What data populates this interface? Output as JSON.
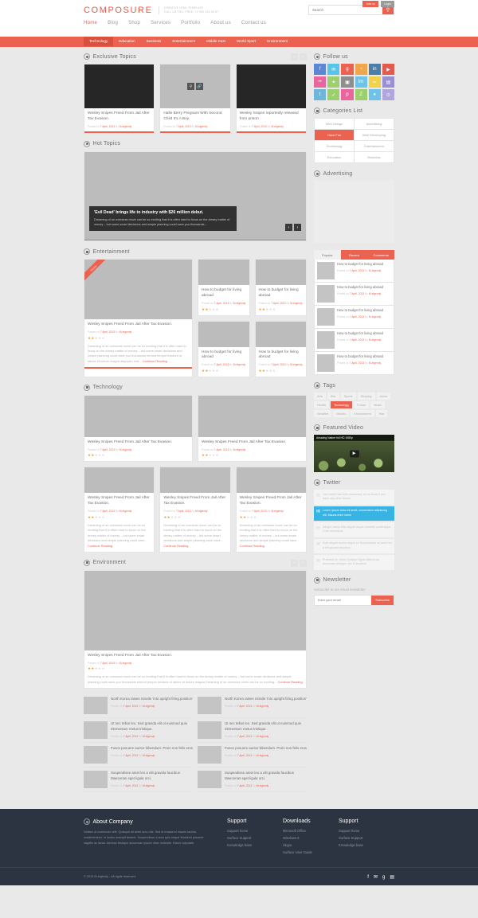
{
  "header": {
    "logo": "COMPOSURE",
    "tagline_line1": "CREATIVE HTML TEMPLATE",
    "tagline_line2": "CALL US TOLL FREE: +2 000 123 45 67",
    "search_placeholder": "Search",
    "search_value": "",
    "search_icon": "search-icon",
    "join_label": "Join us",
    "login_label": "Login",
    "nav": [
      {
        "label": "Home",
        "active": true
      },
      {
        "label": "Blog",
        "active": false
      },
      {
        "label": "Shop",
        "active": false
      },
      {
        "label": "Services",
        "active": false
      },
      {
        "label": "Portfolio",
        "active": false
      },
      {
        "label": "About us",
        "active": false
      },
      {
        "label": "Contact us",
        "active": false
      }
    ],
    "subnav": [
      {
        "label": "Technology",
        "active": true
      },
      {
        "label": "Education",
        "active": false
      },
      {
        "label": "Business",
        "active": false
      },
      {
        "label": "Entertainment",
        "active": false
      },
      {
        "label": "Middle East",
        "active": false
      },
      {
        "label": "World Sport",
        "active": false
      },
      {
        "label": "Environment",
        "active": false
      }
    ]
  },
  "meta_prefix": "Posted on ",
  "meta_date": "7 April, 2013",
  "meta_by": " By ",
  "meta_author": "M-elgendy",
  "continue_label": "Continue Reading",
  "exclusive": {
    "title": "Exclusive Topics",
    "items": [
      {
        "title": "Wesley Snipes Freed From Jail After Tax Evasion.",
        "dark": true
      },
      {
        "title": "Halle Berry Pregnant With Second Child It's A Boy.",
        "dark": false
      },
      {
        "title": "Wesley Snipes reportedly released from prison",
        "dark": true
      }
    ]
  },
  "hot": {
    "title": "Hot Topics",
    "caption_title": "'Evil Dead' brings life to industry with $26 million debut.",
    "caption_text": "Dreaming of an overseas move can be so exciting that it is often hard to focus on the dreary matter of money – but some smart decisions and simple planning could save you thousands..."
  },
  "entertainment": {
    "title": "Entertainment",
    "ribbon": "Sticky",
    "feature": {
      "title": "Wesley Snipes Freed From Jail After Tax Evasion.",
      "excerpt": "Dreaming of an overseas move can be so exciting that it is often hard to focus on the dreary matter of money – but some smart decisions and simple planning could save you thousands eirmod tempor invidunt ut labore et dolore magna aliquyam erat... "
    },
    "small_title": "How to budget for living abroad",
    "small_count": 4
  },
  "technology": {
    "title": "Technology",
    "big_title": "Wesley Snipes Freed From Jail After Tax Evasion.",
    "small_title": "Wesley Snipes Freed From Jail After Tax Evasion.",
    "small_excerpt": "Dreaming of an overseas move can be so exciting that it is often hard to focus on the dreary matter of money – but some smart decisions and simple planning could save... "
  },
  "environment": {
    "title": "Environment",
    "feature_title": "Wesley Snipes Freed From Jail After Tax Evasion.",
    "feature_excerpt": "Dreaming of an overseas move can be so exciting that it is often hard to focus on the dreary matter of money – but some smart decisions and simple planning could save you thousands eirmod tempor invidunt ut labore et dolore magna Dreaming of an overseas move can be so exciting... ",
    "posts": [
      "North Korea raises missile 'into upright firing position'",
      "North Korea raises missile 'into upright firing position'",
      "Ut nec tellus leo. Sed gravida elit ut euismod quis elementum metus tristique.",
      "Ut nec tellus leo. Sed gravida elit ut euismod quis elementum metus tristique.",
      "Fusce posuere auctor bibendum. Proin non felis eros",
      "Fusce posuere auctor bibendum. Proin non felis eros",
      "Suspendisse amet leo a elit gravida faucibus Maecenas eget ligula orci.",
      "Suspendisse amet leo a elit gravida faucibus Maecenas eget ligula orci."
    ]
  },
  "sidebar": {
    "follow": {
      "title": "Follow us",
      "icons": [
        {
          "name": "facebook-icon",
          "glyph": "f",
          "color": "#5b86d4"
        },
        {
          "name": "twitter-icon",
          "glyph": "✉",
          "color": "#56c5e8"
        },
        {
          "name": "google-plus-icon",
          "glyph": "g",
          "color": "#ec6250"
        },
        {
          "name": "rss-icon",
          "glyph": "◔",
          "color": "#f0a64c"
        },
        {
          "name": "linkedin-icon",
          "glyph": "in",
          "color": "#4c7fa8"
        },
        {
          "name": "youtube-icon",
          "glyph": "▶",
          "color": "#e05c4e"
        },
        {
          "name": "flickr-icon",
          "glyph": "••",
          "color": "#e8659e"
        },
        {
          "name": "dribbble-icon",
          "glyph": "✦",
          "color": "#9ccf6e"
        },
        {
          "name": "instagram-icon",
          "glyph": "▣",
          "color": "#8e8e8e"
        },
        {
          "name": "lastfm-icon",
          "glyph": "lm",
          "color": "#6fc3e8"
        },
        {
          "name": "scissors-icon",
          "glyph": "✂",
          "color": "#f2d14b"
        },
        {
          "name": "evernote-icon",
          "glyph": "▤",
          "color": "#9b8fd4"
        },
        {
          "name": "tumblr-icon",
          "glyph": "t",
          "color": "#6fb5d8"
        },
        {
          "name": "forrst-icon",
          "glyph": "✓",
          "color": "#9ccf6e"
        },
        {
          "name": "pinterest-icon",
          "glyph": "p",
          "color": "#e8659e"
        },
        {
          "name": "zerply-icon",
          "glyph": "Z",
          "color": "#9ccf6e"
        },
        {
          "name": "skype-icon",
          "glyph": "●",
          "color": "#6fc3e8"
        },
        {
          "name": "dropbox-icon",
          "glyph": "⊙",
          "color": "#b0a6dd"
        }
      ]
    },
    "categories": {
      "title": "Categories List",
      "items": [
        {
          "label": "Web Design",
          "active": false
        },
        {
          "label": "Advertising",
          "active": false
        },
        {
          "label": "Have Fun",
          "active": true
        },
        {
          "label": "Web Developing",
          "active": false
        },
        {
          "label": "Technology",
          "active": false
        },
        {
          "label": "Entertainment",
          "active": false
        },
        {
          "label": "Education",
          "active": false
        },
        {
          "label": "Business",
          "active": false
        }
      ]
    },
    "advertising": {
      "title": "Advertising"
    },
    "tabwidget": {
      "tabs": [
        {
          "label": "Popular",
          "active": true
        },
        {
          "label": "Recent",
          "active": false
        },
        {
          "label": "Comments",
          "active": false
        }
      ],
      "item_title": "How to budget for living abroad",
      "item_count": 5
    },
    "tags": {
      "title": "Tags",
      "items": [
        {
          "label": "Arts",
          "active": false
        },
        {
          "label": "War",
          "active": false
        },
        {
          "label": "Sports",
          "active": false
        },
        {
          "label": "Shoping",
          "active": false
        },
        {
          "label": "Autos",
          "active": false
        },
        {
          "label": "Health",
          "active": false
        },
        {
          "label": "Technology",
          "active": true
        },
        {
          "label": "Future",
          "active": false
        },
        {
          "label": "Music",
          "active": false
        },
        {
          "label": "Weather",
          "active": false
        },
        {
          "label": "Movies",
          "active": false
        },
        {
          "label": "Environment",
          "active": false
        },
        {
          "label": "War",
          "active": false
        }
      ]
    },
    "video": {
      "title": "Featured Video",
      "video_title": "Amazing Nature full HD 1080p",
      "play_icon": "play-icon"
    },
    "twitter": {
      "title": "Twitter",
      "items": [
        {
          "text": "Your ticket has been answered, let us know if you have any other issues.",
          "active": false
        },
        {
          "text": "Lorem ipsum dolor sit amet, consectetur adipiscing elit, Mauris enim lorem",
          "active": true
        },
        {
          "text": "Integer varius felis aliquet neque molestie scelerisque. Cras consequat.",
          "active": false
        },
        {
          "text": "Duis aliquet auctor augue eu Suspendisse sit amet leo a elit gravida faucibus.",
          "active": false
        },
        {
          "text": "Praesent ac varius Quisque ligula Maecenas accumsan tristique orci in faucibus.",
          "active": false
        }
      ]
    },
    "newsletter": {
      "title": "Newsletter",
      "subtitle": "Subscribe to our email newsletter",
      "placeholder": "Enter your email",
      "value": "",
      "button": "Subscribe"
    }
  },
  "footer": {
    "about": {
      "title": "About Company",
      "text": "Nullam ut commodo velit. Quisque sit amet arcu nisi. Sed id massa et mauris lacinia condimentum. In luctus suscipit laoreet. Suspendisse a arcu quis neque tincidunt posuere sagittis ac lacus. Aenean tristique accumsan ipsum vitae molestie. Etiam vulputate."
    },
    "columns": [
      {
        "title": "Support",
        "links": [
          "Support home",
          "Surface Support",
          "Knowledge base"
        ]
      },
      {
        "title": "Downloads",
        "links": [
          "Microsoft Office",
          "Windows 8",
          "Skype",
          "Surface User Guide"
        ]
      },
      {
        "title": "Support",
        "links": [
          "Support home",
          "Surface Support",
          "Knowledge base"
        ]
      }
    ],
    "copyright": "© 2013 M-elgendy - All rights reserved.",
    "social": [
      {
        "name": "facebook-icon",
        "glyph": "f"
      },
      {
        "name": "twitter-icon",
        "glyph": "✉"
      },
      {
        "name": "google-plus-icon",
        "glyph": "g"
      },
      {
        "name": "rss-icon",
        "glyph": "▤"
      }
    ]
  }
}
